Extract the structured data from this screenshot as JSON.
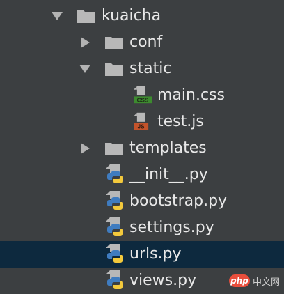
{
  "tree": {
    "root": {
      "label": "kuaicha",
      "expanded": true,
      "icon": "folder-icon"
    },
    "items": [
      {
        "label": "conf",
        "type": "folder",
        "expanded": false,
        "icon": "folder-icon"
      },
      {
        "label": "static",
        "type": "folder",
        "expanded": true,
        "icon": "folder-icon"
      },
      {
        "label": "main.css",
        "type": "css",
        "badge": "CSS",
        "icon": "css-file-icon"
      },
      {
        "label": "test.js",
        "type": "js",
        "badge": "JS",
        "icon": "js-file-icon"
      },
      {
        "label": "templates",
        "type": "folder",
        "expanded": false,
        "icon": "folder-icon"
      },
      {
        "label": "__init__.py",
        "type": "python",
        "icon": "python-file-icon"
      },
      {
        "label": "bootstrap.py",
        "type": "python",
        "icon": "python-file-icon"
      },
      {
        "label": "settings.py",
        "type": "python",
        "icon": "python-file-icon"
      },
      {
        "label": "urls.py",
        "type": "python",
        "icon": "python-file-icon",
        "selected": true
      },
      {
        "label": "views.py",
        "type": "python",
        "icon": "python-file-icon"
      }
    ]
  },
  "watermark": {
    "badge": "php",
    "text": "中文网"
  },
  "colors": {
    "background": "#3c3f41",
    "selection": "#0d293e",
    "text": "#e8e8e8",
    "folder": "#b8b8b8",
    "css_badge": "#3d8b2f",
    "js_badge": "#c3532b",
    "python_blue": "#3f7cc0",
    "python_yellow": "#f3c93c"
  }
}
